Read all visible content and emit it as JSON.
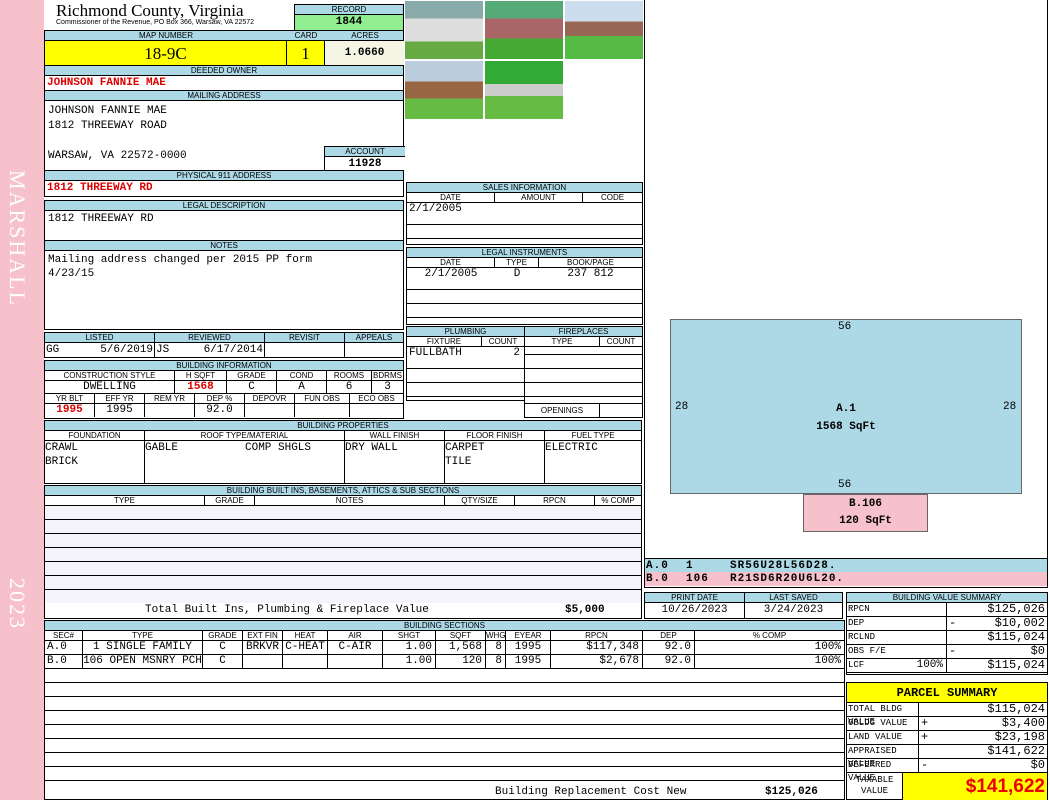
{
  "side": {
    "name": "MARSHALL",
    "year": "2023"
  },
  "header": {
    "county": "Richmond County, Virginia",
    "subtitle": "Commissioner of the Revenue, PO Box 366, Warsaw, VA 22572",
    "record_label": "RECORD",
    "record": "1844"
  },
  "parcel": {
    "map_label": "MAP NUMBER",
    "map": "18-9C",
    "card_label": "CARD",
    "card": "1",
    "acres_label": "ACRES",
    "acres": "1.0660"
  },
  "owner": {
    "label": "DEEDED OWNER",
    "name": "JOHNSON FANNIE MAE"
  },
  "mailing": {
    "label": "MAILING ADDRESS",
    "line1": "JOHNSON FANNIE MAE",
    "line2": "1812 THREEWAY ROAD",
    "line3": "WARSAW, VA 22572-0000",
    "account_label": "ACCOUNT",
    "account": "11928"
  },
  "physical": {
    "label": "PHYSICAL 911 ADDRESS",
    "value": "1812 THREEWAY RD"
  },
  "legal": {
    "label": "LEGAL DESCRIPTION",
    "value": "1812 THREEWAY RD"
  },
  "notes": {
    "label": "NOTES",
    "line1": "Mailing address changed per 2015 PP form",
    "line2": "4/23/15"
  },
  "sales": {
    "label": "SALES INFORMATION",
    "cols": [
      "DATE",
      "AMOUNT",
      "CODE"
    ],
    "rows": [
      {
        "date": "2/1/2005",
        "amount": "",
        "code": ""
      }
    ]
  },
  "instruments": {
    "label": "LEGAL INSTRUMENTS",
    "cols": [
      "DATE",
      "TYPE",
      "BOOK/PAGE"
    ],
    "rows": [
      {
        "date": "2/1/2005",
        "type": "D",
        "book": "237 812"
      }
    ]
  },
  "review": {
    "listed_label": "LISTED",
    "listed_by": "GG",
    "listed_date": "5/6/2019",
    "reviewed_label": "REVIEWED",
    "reviewed_by": "JS",
    "reviewed_date": "6/17/2014",
    "revisit_label": "REVISIT",
    "appeals_label": "APPEALS"
  },
  "building_info": {
    "label": "BUILDING INFORMATION",
    "h1": [
      "CONSTRUCTION STYLE",
      "H SQFT",
      "GRADE",
      "COND",
      "ROOMS",
      "BDRMS"
    ],
    "v1": [
      "DWELLING",
      "1568",
      "C",
      "A",
      "6",
      "3"
    ],
    "h2": [
      "YR BLT",
      "EFF YR",
      "REM YR",
      "DEP %",
      "DEPOVR",
      "FUN OBS",
      "ECO OBS"
    ],
    "v2": [
      "1995",
      "1995",
      "",
      "92.0",
      "",
      "",
      ""
    ]
  },
  "plumbing": {
    "label": "PLUMBING",
    "cols": [
      "FIXTURE",
      "COUNT"
    ],
    "fixture": "FULLBATH",
    "count": "2"
  },
  "fireplaces": {
    "label": "FIREPLACES",
    "cols": [
      "TYPE",
      "COUNT"
    ],
    "openings": "OPENINGS"
  },
  "properties": {
    "label": "BUILDING PROPERTIES",
    "cols": [
      "FOUNDATION",
      "ROOF TYPE/MATERIAL",
      "WALL FINISH",
      "FLOOR FINISH",
      "FUEL TYPE"
    ],
    "foundation": [
      "CRAWL",
      "BRICK"
    ],
    "roof_type": "GABLE",
    "roof_material": "COMP SHGLS",
    "wall": "DRY WALL",
    "floor": [
      "CARPET",
      "TILE"
    ],
    "fuel": "ELECTRIC"
  },
  "builtins": {
    "label": "BUILDING BUILT INS, BASEMENTS, ATTICS & SUB SECTIONS",
    "cols": [
      "TYPE",
      "GRADE",
      "NOTES",
      "QTY/SIZE",
      "RPCN",
      "% COMP"
    ],
    "total_label": "Total Built Ins, Plumbing & Fireplace Value",
    "total": "$5,000"
  },
  "dates": {
    "print_label": "PRINT DATE",
    "print": "10/26/2023",
    "saved_label": "LAST SAVED",
    "saved": "3/24/2023"
  },
  "sections": {
    "label": "BUILDING SECTIONS",
    "cols": [
      "SEC#",
      "TYPE",
      "GRADE",
      "EXT FIN",
      "HEAT",
      "AIR",
      "SHGT",
      "SQFT",
      "WHGT",
      "EYEAR",
      "RPCN",
      "DEP",
      "% COMP"
    ],
    "rows": [
      [
        "A.0",
        "1 SINGLE FAMILY",
        "C",
        "BRKVR",
        "C-HEAT",
        "C-AIR",
        "1.00",
        "1,568",
        "8",
        "1995",
        "$117,348",
        "92.0",
        "100%"
      ],
      [
        "B.0",
        "106 OPEN MSNRY PCH",
        "C",
        "",
        "",
        "",
        "1.00",
        "120",
        "8",
        "1995",
        "$2,678",
        "92.0",
        "100%"
      ]
    ],
    "total_label": "Building Replacement Cost New",
    "total": "$125,026"
  },
  "sketch": {
    "a_top": "56",
    "a_bottom": "56",
    "a_left": "28",
    "a_right": "28",
    "a_name": "A.1",
    "a_area": "1568 SqFt",
    "b_name": "B.106",
    "b_area": "120 SqFt",
    "codes": [
      {
        "sec": "A.0",
        "code": "1",
        "path": "SR56U28L56D28.",
        "color": "#add8e6"
      },
      {
        "sec": "B.0",
        "code": "106",
        "path": "R21SD6R20U6L20.",
        "color": "#f7c1cc"
      }
    ]
  },
  "value_summary": {
    "label": "BUILDING VALUE SUMMARY",
    "rows": [
      {
        "label": "RPCN",
        "sign": "",
        "value": "$125,026"
      },
      {
        "label": "DEP",
        "sign": "-",
        "value": "$10,002"
      },
      {
        "label": "RCLND",
        "sign": "",
        "value": "$115,024"
      },
      {
        "label": "OBS F/E",
        "sign": "-",
        "value": "$0"
      },
      {
        "label": "LCF",
        "pct": "100%",
        "sign": "",
        "value": "$115,024"
      }
    ]
  },
  "parcel_summary": {
    "label": "PARCEL SUMMARY",
    "rows": [
      {
        "label": "TOTAL BLDG VALUE",
        "sign": "",
        "value": "$115,024"
      },
      {
        "label": "OBLDG VALUE",
        "sign": "+",
        "value": "$3,400"
      },
      {
        "label": "LAND VALUE",
        "sign": "+",
        "value": "$23,198"
      },
      {
        "label": "APPRAISED VALUE",
        "sign": "",
        "value": "$141,622"
      },
      {
        "label": "DEFERRED VALUE",
        "sign": "-",
        "value": "$0"
      }
    ],
    "taxable_label1": "TAXABLE",
    "taxable_label2": "VALUE",
    "taxable": "$141,622"
  }
}
